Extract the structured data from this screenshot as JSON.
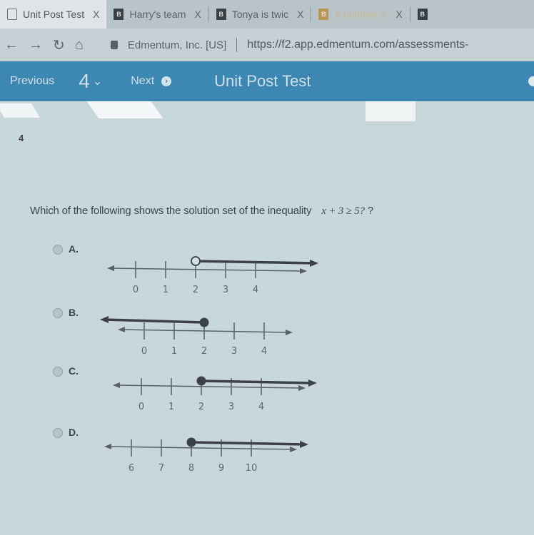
{
  "browser": {
    "tabs": [
      {
        "label": "Unit Post Test",
        "icon": "page-icon",
        "active": true
      },
      {
        "label": "Harry's team",
        "icon": "brainly-icon",
        "active": false
      },
      {
        "label": "Tonya is twic",
        "icon": "brainly-icon",
        "active": false
      },
      {
        "label": "A number is",
        "icon": "brainly-icon",
        "active": false
      },
      {
        "label": "",
        "icon": "brainly-icon",
        "active": false
      }
    ],
    "close_glyph": "X",
    "favicon_letter": "B",
    "site_identity": "Edmentum, Inc. [US]",
    "url": "https://f2.app.edmentum.com/assessments-"
  },
  "app_header": {
    "previous_label": "Previous",
    "question_number": "4",
    "next_label": "Next",
    "title": "Unit Post Test"
  },
  "question": {
    "number": "4",
    "prompt": "Which of the following shows the solution set of the inequality",
    "inequality": "x + 3 ≥ 5?",
    "trailing": "?"
  },
  "options": [
    {
      "letter": "A.",
      "ticks": [
        "0",
        "1",
        "2",
        "3",
        "4"
      ],
      "point_value": "2",
      "point_type": "open",
      "direction": "right"
    },
    {
      "letter": "B.",
      "ticks": [
        "0",
        "1",
        "2",
        "3",
        "4"
      ],
      "point_value": "2",
      "point_type": "closed",
      "direction": "left"
    },
    {
      "letter": "C.",
      "ticks": [
        "0",
        "1",
        "2",
        "3",
        "4"
      ],
      "point_value": "2",
      "point_type": "closed",
      "direction": "right"
    },
    {
      "letter": "D.",
      "ticks": [
        "6",
        "7",
        "8",
        "9",
        "10"
      ],
      "point_value": "8",
      "point_type": "closed",
      "direction": "right"
    }
  ]
}
